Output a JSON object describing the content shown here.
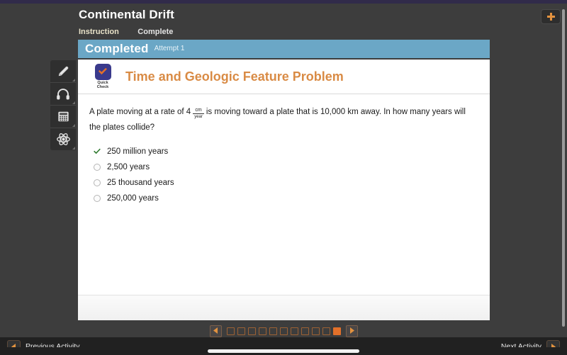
{
  "header": {
    "title": "Continental Drift",
    "tabs": [
      {
        "label": "Instruction",
        "state": "active"
      },
      {
        "label": "Complete",
        "state": "done"
      }
    ],
    "add_icon": "plus-icon",
    "accent_orange": "#e2702a"
  },
  "status": {
    "label": "Completed",
    "attempt": "Attempt 1",
    "bar_color": "#6ba7c6"
  },
  "toolbar": {
    "items": [
      {
        "icon": "pencil-icon",
        "name": "annotate-tool"
      },
      {
        "icon": "headphones-icon",
        "name": "audio-tool"
      },
      {
        "icon": "calculator-icon",
        "name": "calculator-tool"
      },
      {
        "icon": "atom-icon",
        "name": "periodic-table-tool"
      }
    ]
  },
  "activity": {
    "badge": {
      "line1": "Quick",
      "line2": "Check",
      "icon": "check-icon",
      "square_color": "#3a3a8c",
      "check_color": "#e2702a"
    },
    "title": "Time and Geologic Feature Problem",
    "title_color": "#d98b45",
    "question": {
      "part1": "A plate moving at a rate of 4",
      "fraction_numerator": "cm",
      "fraction_denominator": "year",
      "part2": "is moving toward a plate that is 10,000 km away. In how many years will the plates collide?"
    },
    "options": [
      {
        "text": "250 million years",
        "selected": true,
        "marker": "green-check-icon"
      },
      {
        "text": "2,500 years",
        "selected": false,
        "marker": "radio-empty"
      },
      {
        "text": "25 thousand years",
        "selected": false,
        "marker": "radio-empty"
      },
      {
        "text": "250,000 years",
        "selected": false,
        "marker": "radio-empty"
      }
    ]
  },
  "pagination": {
    "prev_icon": "triangle-left-icon",
    "next_icon": "triangle-right-icon",
    "total_pages": 11,
    "current_page": 11
  },
  "footer": {
    "previous_label": "Previous Activity",
    "previous_icon": "triangle-left-icon",
    "next_label": "Next Activity",
    "next_icon": "triangle-right-icon"
  }
}
